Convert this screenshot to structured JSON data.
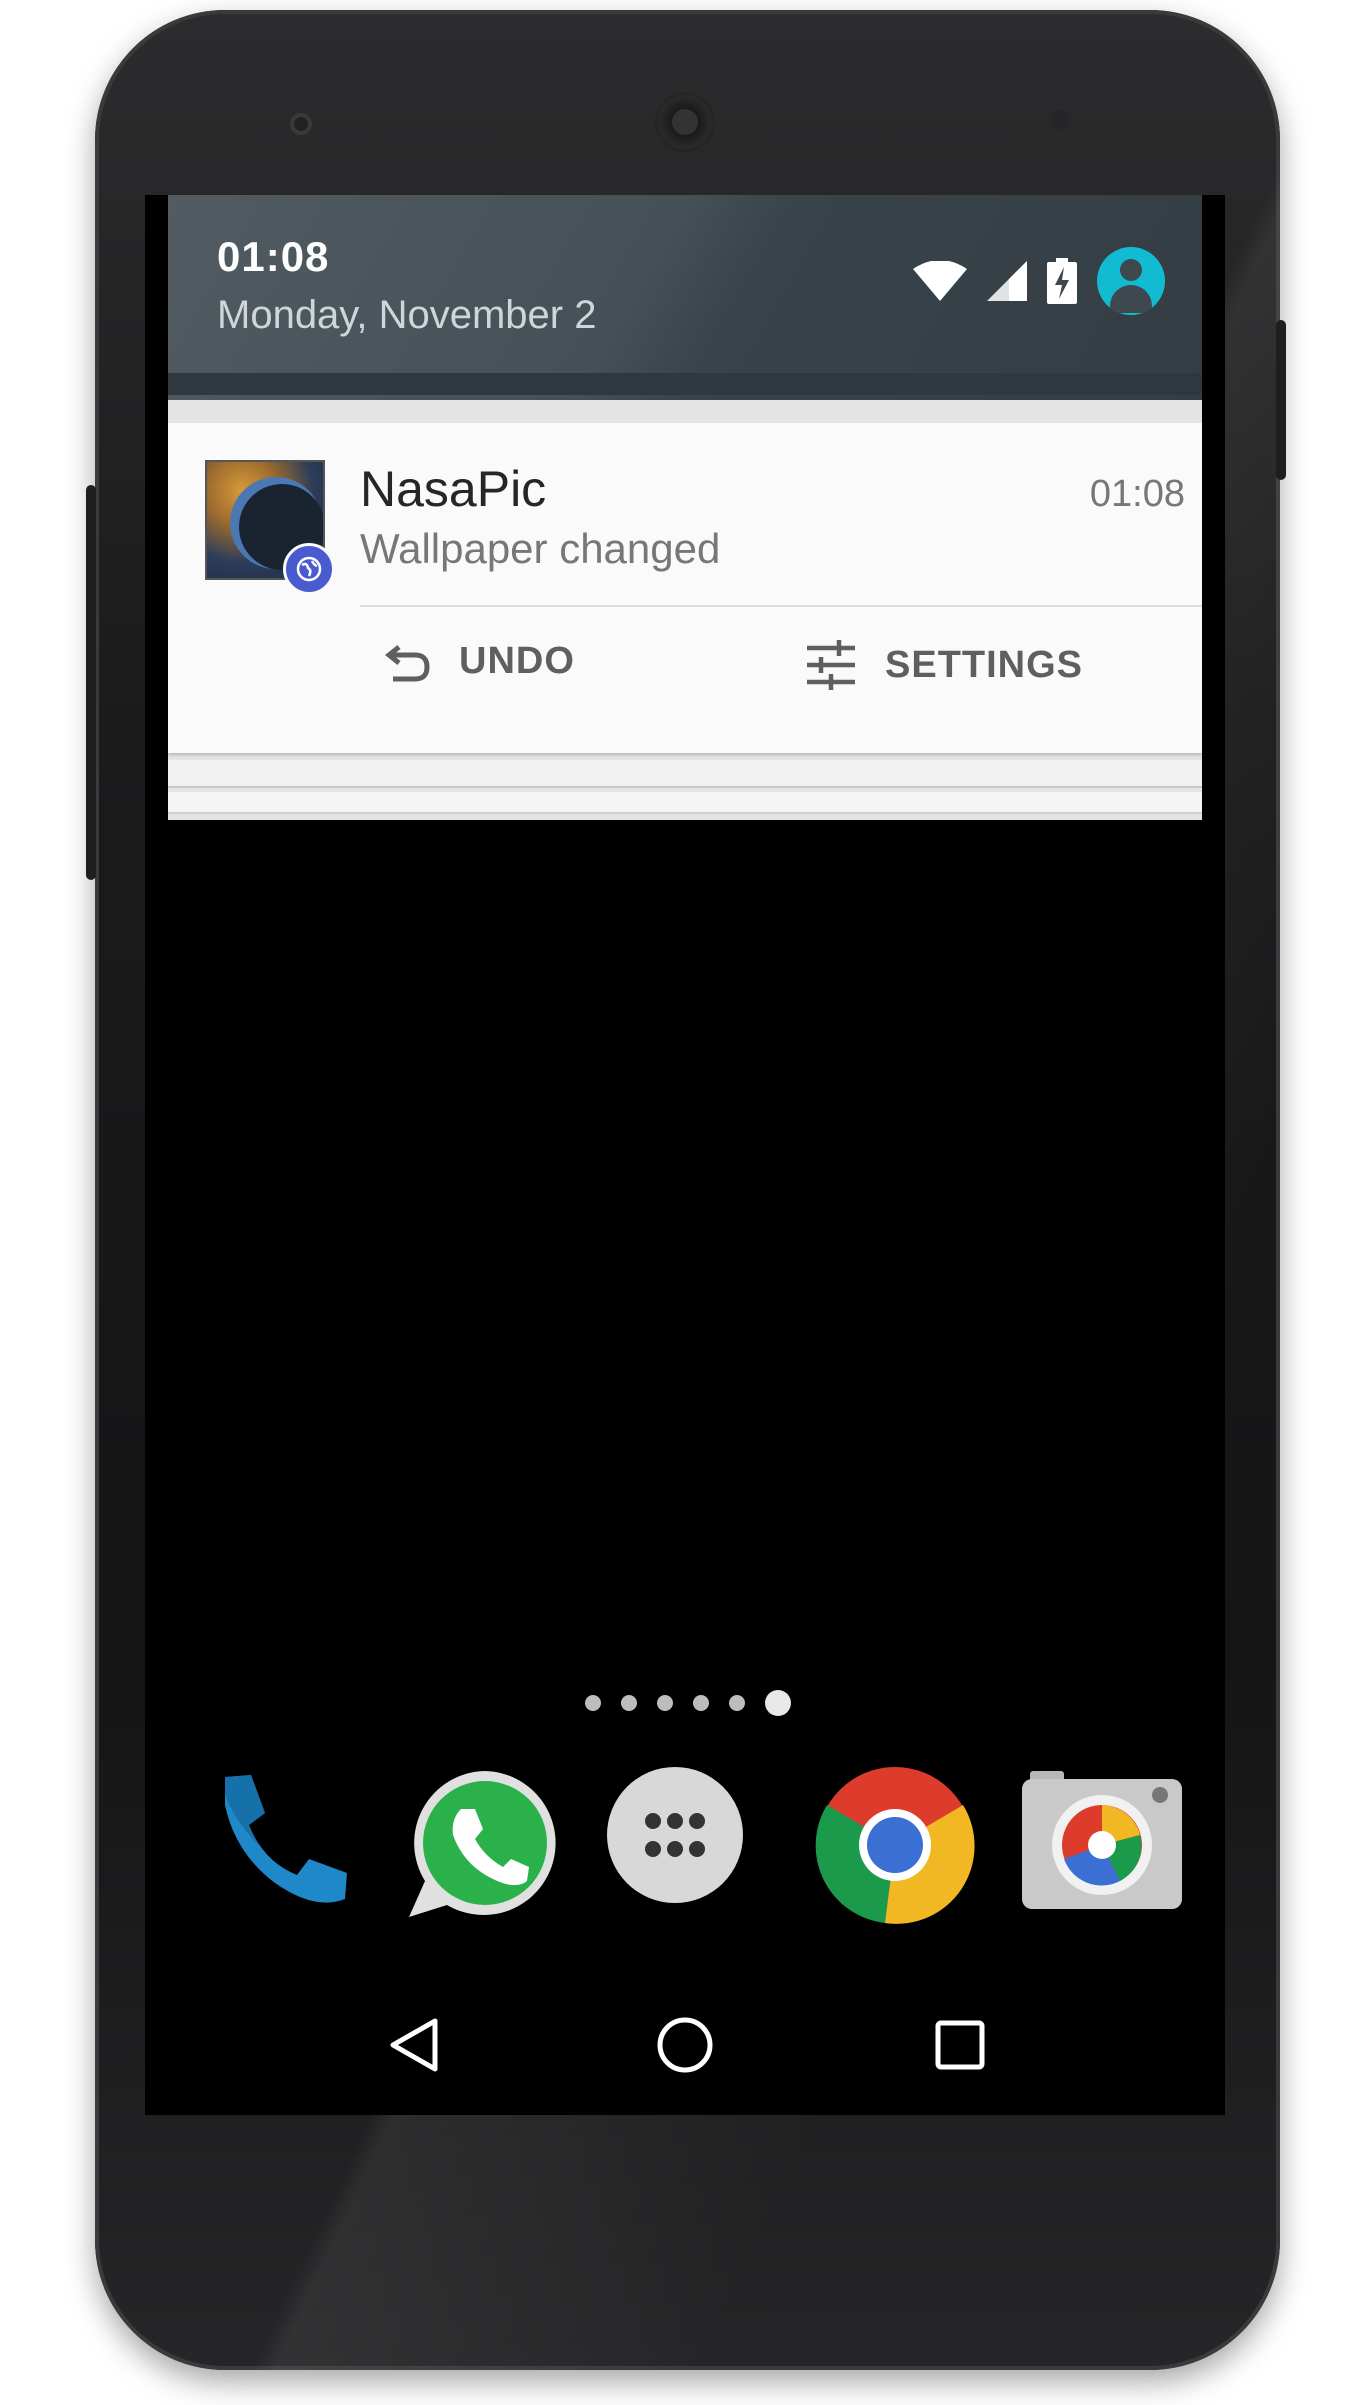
{
  "status_bar": {
    "time": "01:08",
    "date": "Monday, November 2",
    "icons": [
      "wifi-icon",
      "cell-signal-icon",
      "battery-charging-icon",
      "account-avatar-icon"
    ],
    "accent_color": "#11bcd3"
  },
  "notification": {
    "app_name": "NasaPic",
    "time": "01:08",
    "text": "Wallpaper changed",
    "actions": [
      {
        "label": "UNDO",
        "icon": "undo-icon"
      },
      {
        "label": "SETTINGS",
        "icon": "sliders-icon"
      }
    ]
  },
  "home": {
    "page_indicator": {
      "pages": 6,
      "current": 6
    },
    "dock": [
      {
        "name": "Phone",
        "icon": "phone-icon"
      },
      {
        "name": "WhatsApp",
        "icon": "whatsapp-icon"
      },
      {
        "name": "Apps",
        "icon": "app-drawer-icon"
      },
      {
        "name": "Chrome",
        "icon": "chrome-icon"
      },
      {
        "name": "Camera",
        "icon": "camera-icon"
      }
    ]
  },
  "navigation": [
    "back-icon",
    "home-icon",
    "recents-icon"
  ]
}
